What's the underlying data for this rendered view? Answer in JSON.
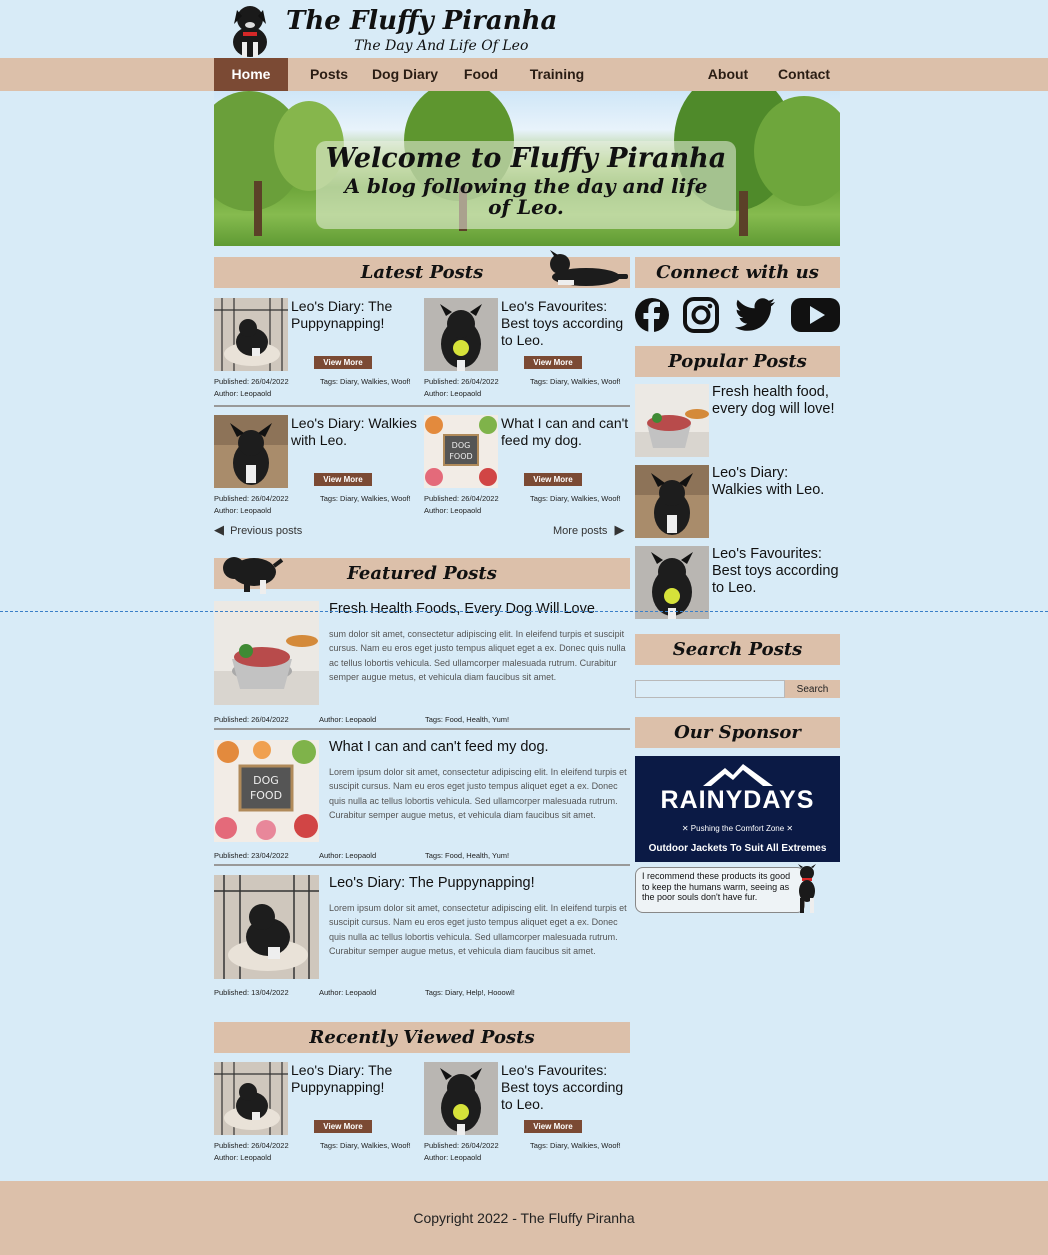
{
  "site": {
    "title": "The Fluffy Piranha",
    "tagline": "The Day And Life Of Leo"
  },
  "nav": {
    "items": [
      "Home",
      "Posts",
      "Dog Diary",
      "Food",
      "Training",
      "About",
      "Contact"
    ],
    "active": "Home"
  },
  "hero": {
    "title": "Welcome to Fluffy Piranha",
    "subtitle": "A blog following the day and life of Leo."
  },
  "latest": {
    "heading": "Latest Posts",
    "view_label": "View More",
    "cards": [
      {
        "title": "Leo's Diary: The Puppynapping!",
        "published": "Published: 26/04/2022",
        "tags": "Tags: Diary, Walkies, Woof!",
        "author": "Author: Leopaold",
        "thumb": "puppy-crate"
      },
      {
        "title": "Leo's Favourites: Best toys according to Leo.",
        "published": "Published: 26/04/2022",
        "tags": "Tags: Diary, Walkies, Woof!",
        "author": "Author: Leopaold",
        "thumb": "puppy-ball"
      },
      {
        "title": "Leo's Diary: Walkies with Leo.",
        "published": "Published: 26/04/2022",
        "tags": "Tags: Diary, Walkies, Woof!",
        "author": "Author: Leopaold",
        "thumb": "puppy-rocks"
      },
      {
        "title": "What I can and can't feed my dog.",
        "published": "Published: 26/04/2022",
        "tags": "Tags: Diary, Walkies, Woof!",
        "author": "Author: Leopaold",
        "thumb": "dog-food"
      }
    ],
    "prev_label": "Previous posts",
    "more_label": "More posts"
  },
  "featured": {
    "heading": "Featured Posts",
    "posts": [
      {
        "title": "Fresh Health Foods, Every Dog Will Love",
        "body": "sum dolor sit amet, consectetur adipiscing elit. In eleifend turpis et suscipit cursus. Nam eu eros eget justo tempus aliquet eget a ex. Donec quis nulla ac tellus lobortis vehicula. Sed ullamcorper malesuada rutrum. Curabitur semper augue metus, et vehicula diam faucibus sit amet.",
        "published": "Published: 26/04/2022",
        "author": "Author: Leopaold",
        "tags": "Tags: Food, Health, Yum!",
        "img": "fresh-food-bowl"
      },
      {
        "title": "What I can and can't feed my dog.",
        "body": "Lorem ipsum dolor sit amet, consectetur adipiscing elit. In eleifend turpis et suscipit cursus. Nam eu eros eget justo tempus aliquet eget a ex. Donec quis nulla ac tellus lobortis vehicula. Sed ullamcorper malesuada rutrum. Curabitur semper augue metus, et vehicula diam faucibus sit amet.",
        "published": "Published: 23/04/2022",
        "author": "Author: Leopaold",
        "tags": "Tags: Food, Health, Yum!",
        "img": "dog-food"
      },
      {
        "title": "Leo's Diary: The Puppynapping!",
        "body": "Lorem ipsum dolor sit amet, consectetur adipiscing elit. In eleifend turpis et suscipit cursus. Nam eu eros eget justo tempus aliquet eget a ex. Donec quis nulla ac tellus lobortis vehicula. Sed ullamcorper malesuada rutrum. Curabitur semper augue metus, et vehicula diam faucibus sit amet.",
        "published": "Published: 13/04/2022",
        "author": "Author: Leopaold",
        "tags": "Tags: Diary, Help!, Hooowl!",
        "img": "puppy-crate"
      }
    ]
  },
  "recent": {
    "heading": "Recently Viewed Posts",
    "view_label": "View More",
    "cards": [
      {
        "title": "Leo's Diary: The Puppynapping!",
        "published": "Published: 26/04/2022",
        "tags": "Tags: Diary, Walkies, Woof!",
        "author": "Author: Leopaold",
        "thumb": "puppy-crate"
      },
      {
        "title": "Leo's Favourites: Best toys according to Leo.",
        "published": "Published: 26/04/2022",
        "tags": "Tags: Diary, Walkies, Woof!",
        "author": "Author: Leopaold",
        "thumb": "puppy-ball"
      }
    ]
  },
  "sidebar": {
    "connect_heading": "Connect with us",
    "social_icons": [
      "facebook-icon",
      "instagram-icon",
      "twitter-icon",
      "youtube-icon"
    ],
    "popular_heading": "Popular Posts",
    "popular": [
      {
        "title": "Fresh health food, every dog will love!",
        "img": "fresh-food-bowl"
      },
      {
        "title": "Leo's Diary: Walkies with Leo.",
        "img": "puppy-rocks"
      },
      {
        "title": "Leo's Favourites: Best toys according to Leo.",
        "img": "puppy-ball"
      }
    ],
    "search_heading": "Search Posts",
    "search_placeholder": "",
    "search_button": "Search",
    "sponsor_heading": "Our Sponsor",
    "sponsor": {
      "name": "RAINYDAYS",
      "line": "✕ Pushing the Comfort Zone ✕",
      "slogan": "Outdoor Jackets To Suit All Extremes"
    },
    "bubble": "I recommend these products its good to keep the humans warm, seeing as the poor souls don't have fur."
  },
  "footer": {
    "copyright": "Copyright 2022 - The Fluffy Piranha"
  },
  "colors": {
    "page_bg": "#d8ebf7",
    "accent_beige": "#dcc0aa",
    "accent_brown": "#7b4a34",
    "sponsor_navy": "#0b1a45"
  }
}
